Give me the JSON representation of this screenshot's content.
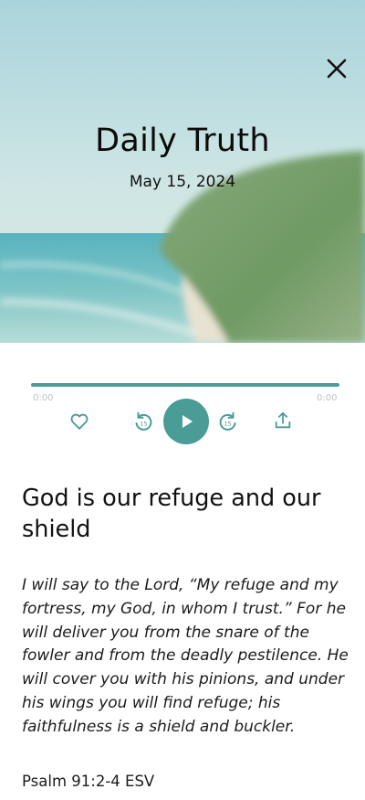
{
  "header": {
    "title": "Daily Truth",
    "date": "May 15, 2024",
    "close_icon": "close-icon"
  },
  "player": {
    "progress_fraction": 1.0,
    "elapsed": "0:00",
    "duration": "0:00",
    "rewind_label": "15",
    "forward_label": "15",
    "icons": [
      "heart-icon",
      "rewind-15-icon",
      "play-icon",
      "forward-15-icon",
      "share-icon"
    ],
    "accent_color": "#4a9c97"
  },
  "devotion": {
    "heading": "God is our refuge and our shield",
    "verse": "I will say to the Lord, “My refuge and my fortress, my God, in whom I trust.” For he will deliver you from the snare of the fowler and from the deadly pestilence. He will cover you with his pinions, and under his wings you will find refuge; his faithfulness is a shield and buckler.",
    "reference": "Psalm 91:2-4 ESV"
  }
}
